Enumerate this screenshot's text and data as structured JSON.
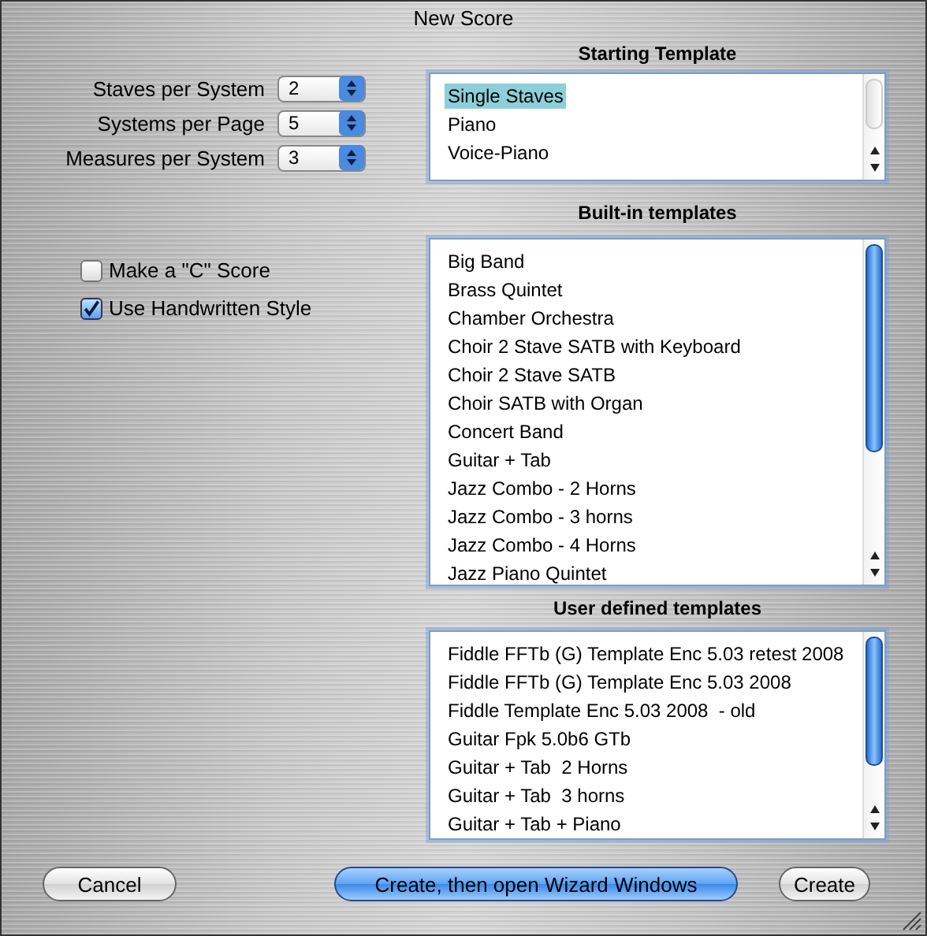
{
  "window": {
    "title": "New Score"
  },
  "settings": [
    {
      "label": "Staves per System",
      "value": "2"
    },
    {
      "label": "Systems per Page",
      "value": "5"
    },
    {
      "label": "Measures per System",
      "value": "3"
    }
  ],
  "options": [
    {
      "label": "Make a \"C\" Score",
      "checked": false
    },
    {
      "label": "Use Handwritten Style",
      "checked": true
    }
  ],
  "starting_template": {
    "heading": "Starting Template",
    "items": [
      {
        "label": "Single Staves",
        "selected": true
      },
      {
        "label": "Piano",
        "selected": false
      },
      {
        "label": "Voice-Piano",
        "selected": false
      }
    ]
  },
  "built_in_templates": {
    "heading": "Built-in templates",
    "items": [
      {
        "label": "Big Band",
        "selected": false
      },
      {
        "label": "Brass Quintet",
        "selected": false
      },
      {
        "label": "Chamber Orchestra",
        "selected": false
      },
      {
        "label": "Choir 2 Stave SATB with Keyboard",
        "selected": false
      },
      {
        "label": "Choir 2 Stave SATB",
        "selected": false
      },
      {
        "label": "Choir SATB with Organ",
        "selected": false
      },
      {
        "label": "Concert Band",
        "selected": false
      },
      {
        "label": "Guitar + Tab",
        "selected": false
      },
      {
        "label": "Jazz Combo - 2 Horns",
        "selected": false
      },
      {
        "label": "Jazz Combo - 3 horns",
        "selected": false
      },
      {
        "label": "Jazz Combo - 4 Horns",
        "selected": false
      },
      {
        "label": "Jazz Piano Quintet",
        "selected": false
      }
    ]
  },
  "user_defined_templates": {
    "heading": "User defined templates",
    "items": [
      {
        "label": "Fiddle FFTb (G) Template Enc 5.03 retest 2008",
        "selected": false
      },
      {
        "label": "Fiddle FFTb (G) Template Enc 5.03 2008",
        "selected": false
      },
      {
        "label": "Fiddle Template Enc 5.03 2008  - old",
        "selected": false
      },
      {
        "label": "Guitar Fpk 5.0b6 GTb",
        "selected": false
      },
      {
        "label": "Guitar + Tab  2 Horns",
        "selected": false
      },
      {
        "label": "Guitar + Tab  3 horns",
        "selected": false
      },
      {
        "label": "Guitar + Tab + Piano",
        "selected": false
      }
    ]
  },
  "buttons": [
    {
      "label": "Cancel",
      "kind": "plain"
    },
    {
      "label": "Create, then open Wizard Windows",
      "kind": "default"
    },
    {
      "label": "Create",
      "kind": "plain"
    }
  ]
}
